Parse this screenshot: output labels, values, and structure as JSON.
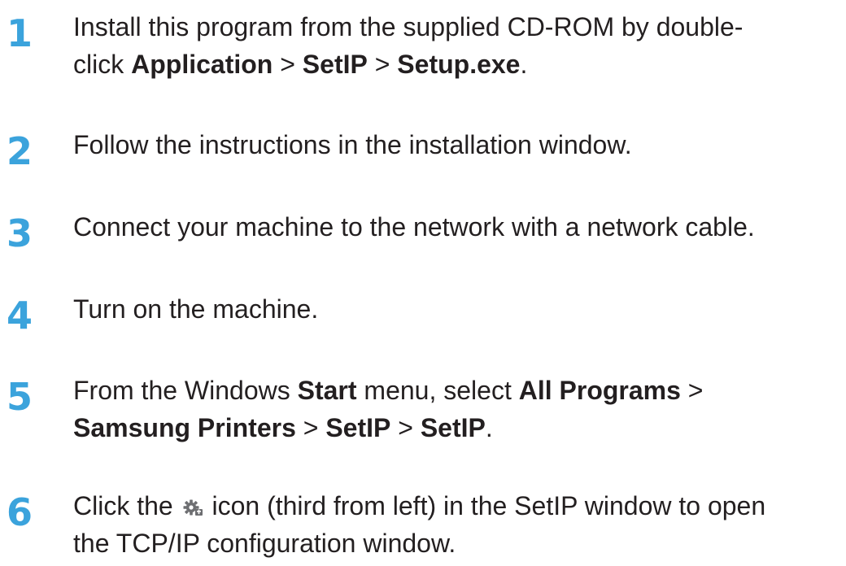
{
  "steps": [
    {
      "number": "1",
      "line1": {
        "t1": "Install this program from the supplied CD-ROM by double-"
      },
      "line2": {
        "t1": "click ",
        "b1": "Application",
        "t2": " > ",
        "b2": "SetIP",
        "t3": " > ",
        "b3": "Setup.exe",
        "t4": "."
      }
    },
    {
      "number": "2",
      "line1": {
        "t1": "Follow the instructions in the installation window."
      }
    },
    {
      "number": "3",
      "line1": {
        "t1": "Connect your machine to the network with a network cable."
      }
    },
    {
      "number": "4",
      "line1": {
        "t1": "Turn on the machine."
      }
    },
    {
      "number": "5",
      "line1": {
        "t1": "From the Windows ",
        "b1": "Start",
        "t2": " menu, select ",
        "b2": "All Programs",
        "t3": " >"
      },
      "line2": {
        "b1": "Samsung Printers",
        "t1": " > ",
        "b2": "SetIP",
        "t2": " > ",
        "b3": "SetIP",
        "t3": "."
      }
    },
    {
      "number": "6",
      "line1": {
        "t1": "Click the ",
        "icon": "tcpip-config-gear-icon",
        "t2": " icon (third from left) in the SetIP window to open"
      },
      "line2": {
        "t1": "the TCP/IP configuration window."
      }
    }
  ]
}
